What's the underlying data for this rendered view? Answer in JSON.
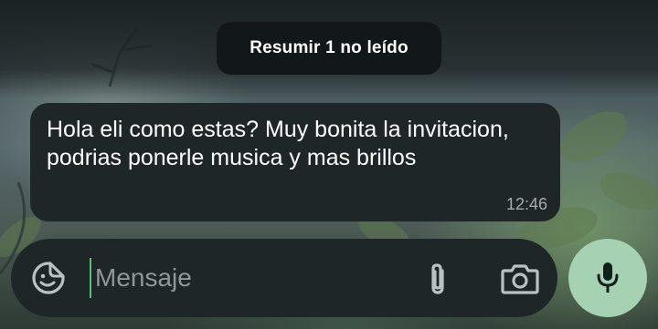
{
  "summary_pill": {
    "label": "Resumir 1 no leído"
  },
  "message": {
    "text": "Hola eli como estas? Muy bonita la invitacion, podrias ponerle musica y mas brillos",
    "time": "12:46"
  },
  "composer": {
    "placeholder": "Mensaje",
    "value": ""
  },
  "icons": {
    "sticker": "sticker-icon",
    "attach": "paperclip-icon",
    "camera": "camera-icon",
    "mic": "microphone-icon"
  },
  "colors": {
    "bubble": "#1f2628",
    "pill": "#121819",
    "mic_button": "#a6d1b3",
    "cursor": "#58c27d",
    "timestamp": "#a4acaf"
  }
}
